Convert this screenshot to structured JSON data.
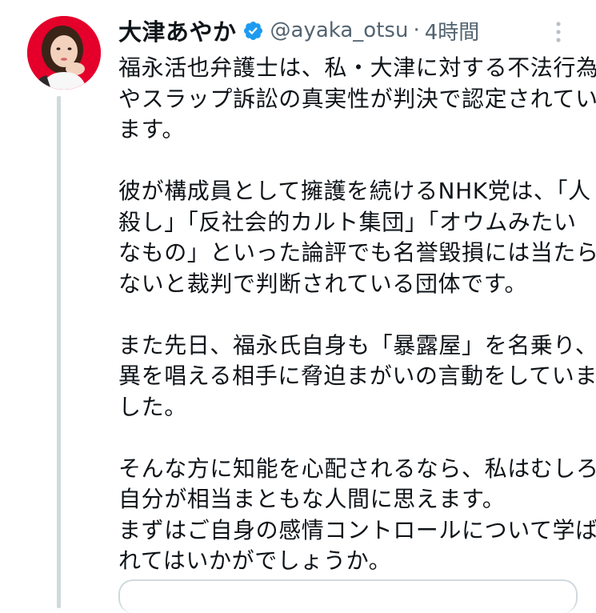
{
  "tweet": {
    "author": {
      "display_name": "大津あやか",
      "handle": "@ayaka_otsu",
      "verified": true,
      "avatar_icon": "profile-photo"
    },
    "separator": "·",
    "time": "4時間",
    "more_icon": "more-vertical-icon",
    "paragraphs": [
      {
        "lines": [
          "福永活也弁護士は、私・大津に対する不法行為",
          "やスラップ訴訟の真実性が判決で認定されてい",
          "ます。"
        ]
      },
      {
        "lines": [
          "彼が構成員として擁護を続けるNHK党は、「人",
          "殺し」「反社会的カルト集団」「オウムみたい",
          "なもの」といった論評でも名誉毀損には当たら",
          "ないと裁判で判断されている団体です。"
        ]
      },
      {
        "lines": [
          "また先日、福永氏自身も「暴露屋」を名乗り、",
          "異を唱える相手に脅迫まがいの言動をしていま",
          "した。"
        ]
      },
      {
        "lines": [
          "そんな方に知能を心配されるなら、私はむしろ",
          "自分が相当まともな人間に思えます。",
          "まずはご自身の感情コントロールについて学ば",
          "れてはいかがでしょうか。"
        ]
      }
    ]
  },
  "colors": {
    "text_primary": "#0f1419",
    "text_secondary": "#536471",
    "verified_blue": "#1d9bf0",
    "thread_line": "#cfd9de",
    "avatar_bg": "#e4002b"
  }
}
